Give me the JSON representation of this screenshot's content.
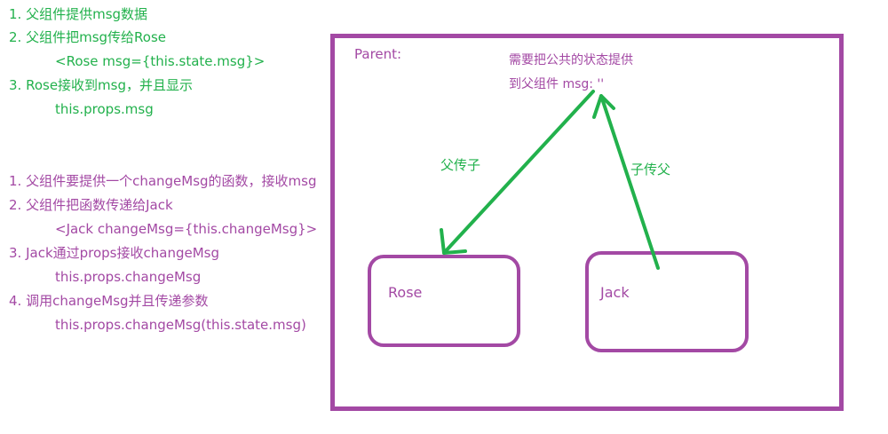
{
  "left_notes": {
    "section1": [
      "1. 父组件提供msg数据",
      "2. 父组件把msg传给Rose",
      "<Rose msg={this.state.msg}>",
      "3. Rose接收到msg，并且显示",
      "this.props.msg"
    ],
    "section2": [
      "1. 父组件要提供一个changeMsg的函数，接收msg",
      "2. 父组件把函数传递给Jack",
      "<Jack   changeMsg={this.changeMsg}>",
      "3. Jack通过props接收changeMsg",
      "this.props.changeMsg",
      "4. 调用changeMsg并且传递参数",
      "this.props.changeMsg(this.state.msg)"
    ]
  },
  "diagram": {
    "parent_label": "Parent:",
    "state_note_line1": "需要把公共的状态提供",
    "state_note_line2": "到父组件   msg: ''",
    "arrow_down_label": "父传子",
    "arrow_up_label": "子传父",
    "child_rose": "Rose",
    "child_jack": "Jack"
  },
  "colors": {
    "green": "#22b14c",
    "purple": "#a349a4"
  }
}
